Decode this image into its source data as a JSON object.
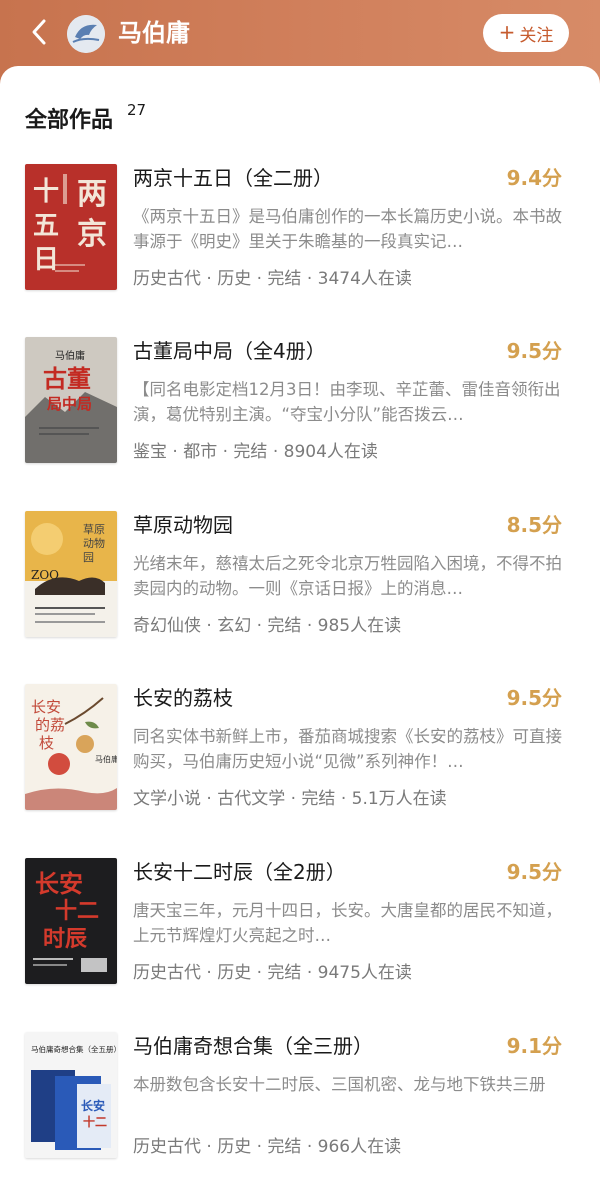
{
  "header": {
    "author_name": "马伯庸",
    "follow_label": "关注",
    "follow_plus": "+",
    "avatar_icon": "feather-icon"
  },
  "section": {
    "title": "全部作品",
    "count": "27"
  },
  "books": [
    {
      "title": "两京十五日（全二册）",
      "rating": "9.4分",
      "desc": "《两京十五日》是马伯庸创作的一本长篇历史小说。本书故事源于《明史》里关于朱瞻基的一段真实记…",
      "meta": "历史古代 · 历史 · 完结 · 3474人在读",
      "cover_text": "两京十五日"
    },
    {
      "title": "古董局中局（全4册）",
      "rating": "9.5分",
      "desc": "【同名电影定档12月3日！由李现、辛芷蕾、雷佳音领衔出演，葛优特别主演。“夺宝小分队”能否拨云…",
      "meta": "鉴宝 · 都市 · 完结 · 8904人在读",
      "cover_text": "古董局中局"
    },
    {
      "title": "草原动物园",
      "rating": "8.5分",
      "desc": "光绪末年，慈禧太后之死令北京万牲园陷入困境，不得不拍卖园内的动物。一则《京话日报》上的消息…",
      "meta": "奇幻仙侠 · 玄幻 · 完结 · 985人在读",
      "cover_text": "草原动物园"
    },
    {
      "title": "长安的荔枝",
      "rating": "9.5分",
      "desc": "同名实体书新鲜上市，番茄商城搜索《长安的荔枝》可直接购买，马伯庸历史短小说“见微”系列神作！…",
      "meta": "文学小说 · 古代文学 · 完结 · 5.1万人在读",
      "cover_text": "长安的荔枝"
    },
    {
      "title": "长安十二时辰（全2册）",
      "rating": "9.5分",
      "desc": "唐天宝三年，元月十四日，长安。大唐皇都的居民不知道，上元节辉煌灯火亮起之时…",
      "meta": "历史古代 · 历史 · 完结 · 9475人在读",
      "cover_text": "长安十二时辰"
    },
    {
      "title": "马伯庸奇想合集（全三册）",
      "rating": "9.1分",
      "desc": "本册数包含长安十二时辰、三国机密、龙与地下铁共三册",
      "meta": "历史古代 · 历史 · 完结 · 966人在读",
      "cover_text": "马伯庸奇想合集（全五册）"
    }
  ],
  "colors": {
    "header_bg": "#cf7d58",
    "rating": "#d4a04f",
    "follow_text": "#c65b2e"
  }
}
